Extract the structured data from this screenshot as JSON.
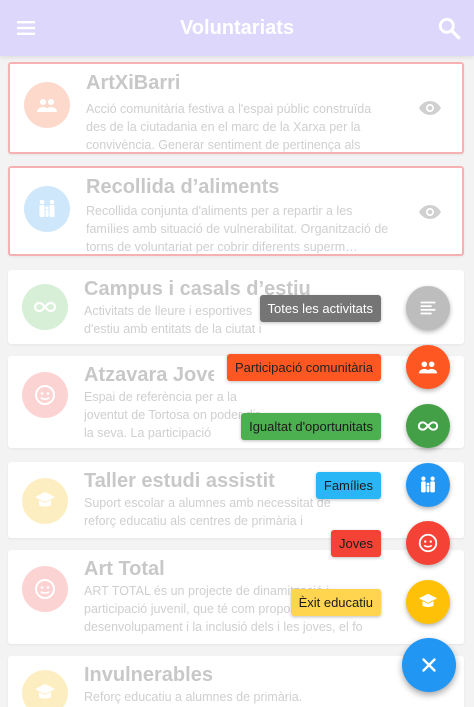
{
  "appbar": {
    "title": "Voluntariats"
  },
  "cards": [
    {
      "title": "ArtXiBarri",
      "desc": "Acció comunitària festiva a l'espai públic construïda des de la ciutadania en el marc de la Xarxa per la convivència. Generar sentiment de pertinença als"
    },
    {
      "title": "Recollida d’aliments",
      "desc": "Recollida conjunta d'aliments per a repartir a les famílies amb situació de vulnerabilitat. Organització de torns de voluntariat per cobrir diferents superm…"
    },
    {
      "title": "Campus i casals d’estiu",
      "desc": "Activitats de lleure i esportives d'estiu amb entitats de la ciutat i voluntariat"
    },
    {
      "title": "Atzavara Jove",
      "desc": "Espai de referència per a la joventut de Tortosa on poder dir la seva. La participació"
    },
    {
      "title": "Taller estudi assistit",
      "desc": "Suport escolar a alumnes amb necessitat de reforç educatiu als centres de primària i secundària"
    },
    {
      "title": "Art Total",
      "desc": "ART TOTAL és un projecte de dinamització i participació juvenil, que té com proposta el desenvolupament i la inclusió dels i les joves, el fo"
    },
    {
      "title": "Invulnerables",
      "desc": "Reforç educatiu a alumnes de primària. Invulnerables"
    }
  ],
  "fab_menu": [
    {
      "label": "Totes les activitats",
      "icon": "list-icon",
      "color": "#9e9e9e",
      "label_bg": "#757575"
    },
    {
      "label": "Participació comunitària",
      "icon": "group-icon",
      "color": "#ff5722",
      "label_bg": "#ff5722"
    },
    {
      "label": "Igualtat d'oportunitats",
      "icon": "infinity-icon",
      "color": "#43a047",
      "label_bg": "#4caf50"
    },
    {
      "label": "Famílies",
      "icon": "family-icon",
      "color": "#2196f3",
      "label_bg": "#29b6f6"
    },
    {
      "label": "Joves",
      "icon": "face-icon",
      "color": "#f44336",
      "label_bg": "#f44336"
    },
    {
      "label": "Èxit educatiu",
      "icon": "school-icon",
      "color": "#ffc107",
      "label_bg": "#ffd54f"
    }
  ],
  "colors": {
    "appbar": "#ddd8fb",
    "fab": "#2196f3"
  }
}
